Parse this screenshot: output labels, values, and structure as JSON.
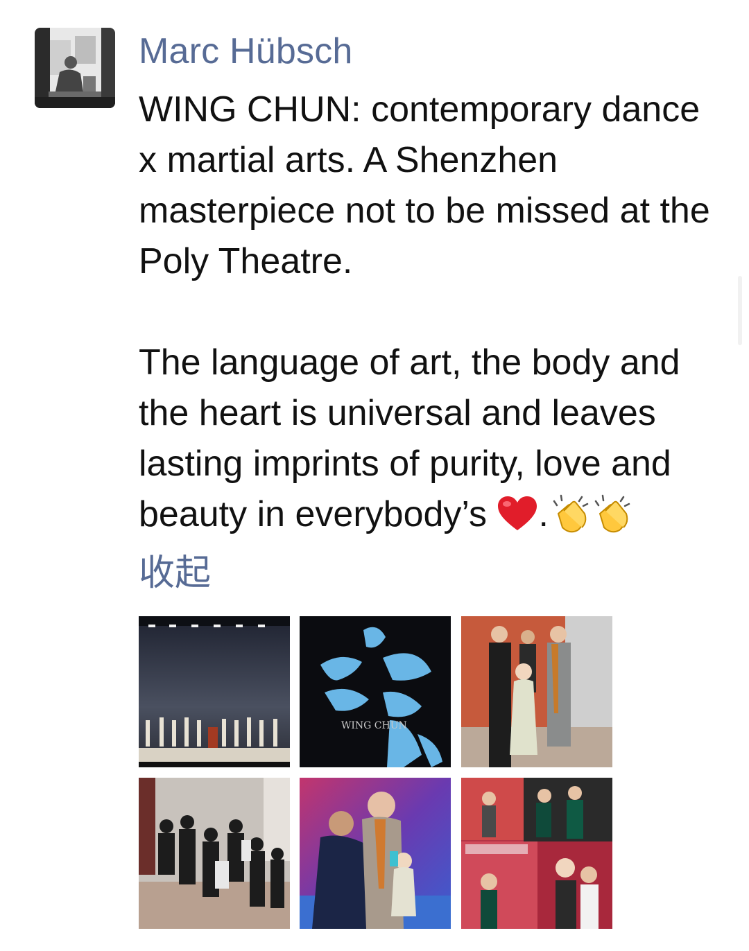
{
  "post": {
    "author": "Marc Hübsch",
    "paragraph1": "WING CHUN: contemporary dance x martial arts. A Shenzhen masterpiece not to be missed at the Poly Theatre.",
    "paragraph2_text": "The language of art, the body and the heart is universal and leaves lasting imprints of purity, love and beauty in everybody’s",
    "paragraph2_emojis": [
      "heart",
      ".",
      "clapping-hands",
      "clapping-hands"
    ],
    "collapse_label": "收起",
    "photos": [
      {
        "name": "stage-performance-photo"
      },
      {
        "name": "wing-chun-poster-photo",
        "caption_text": "WING CHUN"
      },
      {
        "name": "family-with-performer-photo"
      },
      {
        "name": "crowd-backstage-photo"
      },
      {
        "name": "award-ceremony-photo"
      },
      {
        "name": "backdrop-collage-photo"
      }
    ]
  },
  "colors": {
    "link": "#576b95",
    "text": "#111111",
    "background": "#ffffff"
  }
}
